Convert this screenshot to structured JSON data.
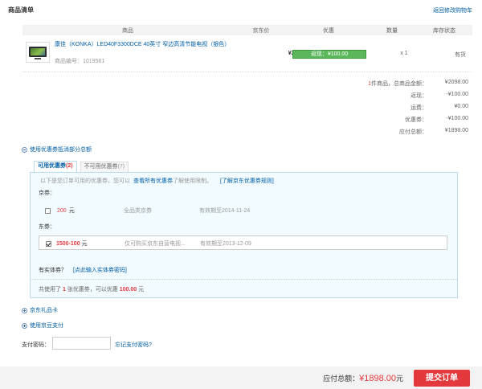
{
  "header": {
    "title": "商品清单",
    "back_link": "返回修改购物车"
  },
  "table_headers": [
    "商品",
    "京东价",
    "优惠",
    "数量",
    "库存状态"
  ],
  "product": {
    "name": "康佳（KONKA）LED40F3300DCE 40英寸 窄边高清节能电视（银色）",
    "code": "商品编号：1019561",
    "price": "¥2098.00",
    "promo": "返现：¥100.00",
    "qty": "x 1",
    "stock": "有货"
  },
  "summary": {
    "count": "1",
    "count_label": "件商品，总商品金额：",
    "rows": [
      {
        "label": "",
        "value": "¥2098.00"
      },
      {
        "label": "返现：",
        "value": "-¥100.00"
      },
      {
        "label": "运费：",
        "value": "¥0.00"
      },
      {
        "label": "优惠券：",
        "value": "-¥100.00"
      },
      {
        "label": "应付总额：",
        "value": "¥1898.00"
      }
    ]
  },
  "coupon_toggle": "使用优惠券抵消部分总额",
  "tabs": {
    "active_label": "可用优惠券",
    "active_count": "(2)",
    "inactive_label": "不可用优惠券",
    "inactive_count": "(7)"
  },
  "coupon_panel": {
    "hint": "以下是您订单可用的优惠券，您可以",
    "view_all": "查看所有优惠券",
    "hint_tail": "了解使用限制。",
    "learn": "[了解京东优惠券规则]",
    "jing_label": "京券：",
    "jing_coupon": {
      "amount": "200",
      "unit": "元",
      "scope": "全品类京券",
      "validity": "有效期至2014-11-24"
    },
    "dong_label": "东券：",
    "dong_coupon": {
      "amount": "1500-100",
      "unit": "元",
      "scope": "仅可购买京东自营电视...",
      "validity": "有效期至2013-12-09"
    },
    "entity_label": "有实体券？",
    "entity_link": "[点此输入实体券密码]",
    "footer_pre": "共使用了",
    "footer_count": "1",
    "footer_mid": "张优惠券，可以优惠",
    "footer_amount": "100.00",
    "footer_unit": "元"
  },
  "gift_card": "京东礼品卡",
  "jing_bean": "使用京豆支付",
  "password": {
    "label": "支付密码：",
    "placeholder": "",
    "forgot": "忘记支付密码?"
  },
  "footer": {
    "total_label": "应付总额：",
    "total_amount": "¥1898.00",
    "total_unit": "元",
    "submit": "提交订单"
  }
}
